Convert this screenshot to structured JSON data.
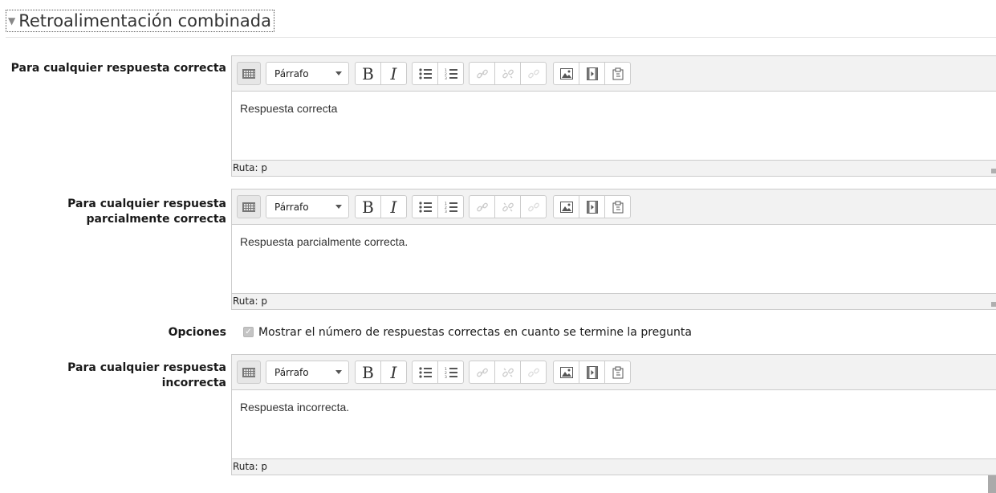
{
  "section": {
    "title": "Retroalimentación combinada"
  },
  "editors": [
    {
      "label": "Para cualquier respuesta correcta",
      "format": "Párrafo",
      "content": "Respuesta correcta",
      "path": "Ruta: p"
    },
    {
      "label": "Para cualquier respuesta parcialmente correcta",
      "format": "Párrafo",
      "content": "Respuesta parcialmente correcta.",
      "path": "Ruta: p"
    },
    {
      "label": "Para cualquier respuesta incorrecta",
      "format": "Párrafo",
      "content": "Respuesta incorrecta.",
      "path": "Ruta: p"
    }
  ],
  "options": {
    "label": "Opciones",
    "checkbox_label": "Mostrar el número de respuestas correctas en cuanto se termine la pregunta",
    "checked": true
  },
  "toolbar_icons": [
    "show-more-icon",
    "bold-icon",
    "italic-icon",
    "unordered-list-icon",
    "ordered-list-icon",
    "link-icon",
    "unlink-icon",
    "anchor-icon",
    "image-icon",
    "media-icon",
    "paste-icon"
  ]
}
